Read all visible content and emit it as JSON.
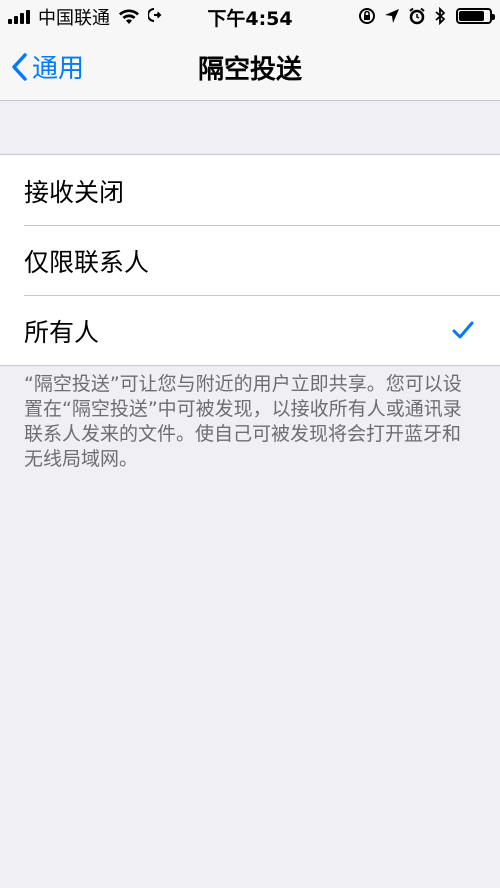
{
  "status_bar": {
    "carrier": "中国联通",
    "time": "下午4:54",
    "battery_level": 0.9
  },
  "nav": {
    "back_label": "通用",
    "title": "隔空投送"
  },
  "options": [
    {
      "label": "接收关闭",
      "selected": false
    },
    {
      "label": "仅限联系人",
      "selected": false
    },
    {
      "label": "所有人",
      "selected": true
    }
  ],
  "footer_note": "“隔空投送”可让您与附近的用户立即共享。您可以设置在“隔空投送”中可被发现，以接收所有人或通讯录联系人发来的文件。使自己可被发现将会打开蓝牙和无线局域网。",
  "colors": {
    "accent": "#007aff",
    "background": "#efeff4",
    "separator": "#c8c7cc",
    "footer_text": "#6d6d72"
  },
  "icons": {
    "back": "chevron-left-icon",
    "selected": "checkmark-icon"
  }
}
